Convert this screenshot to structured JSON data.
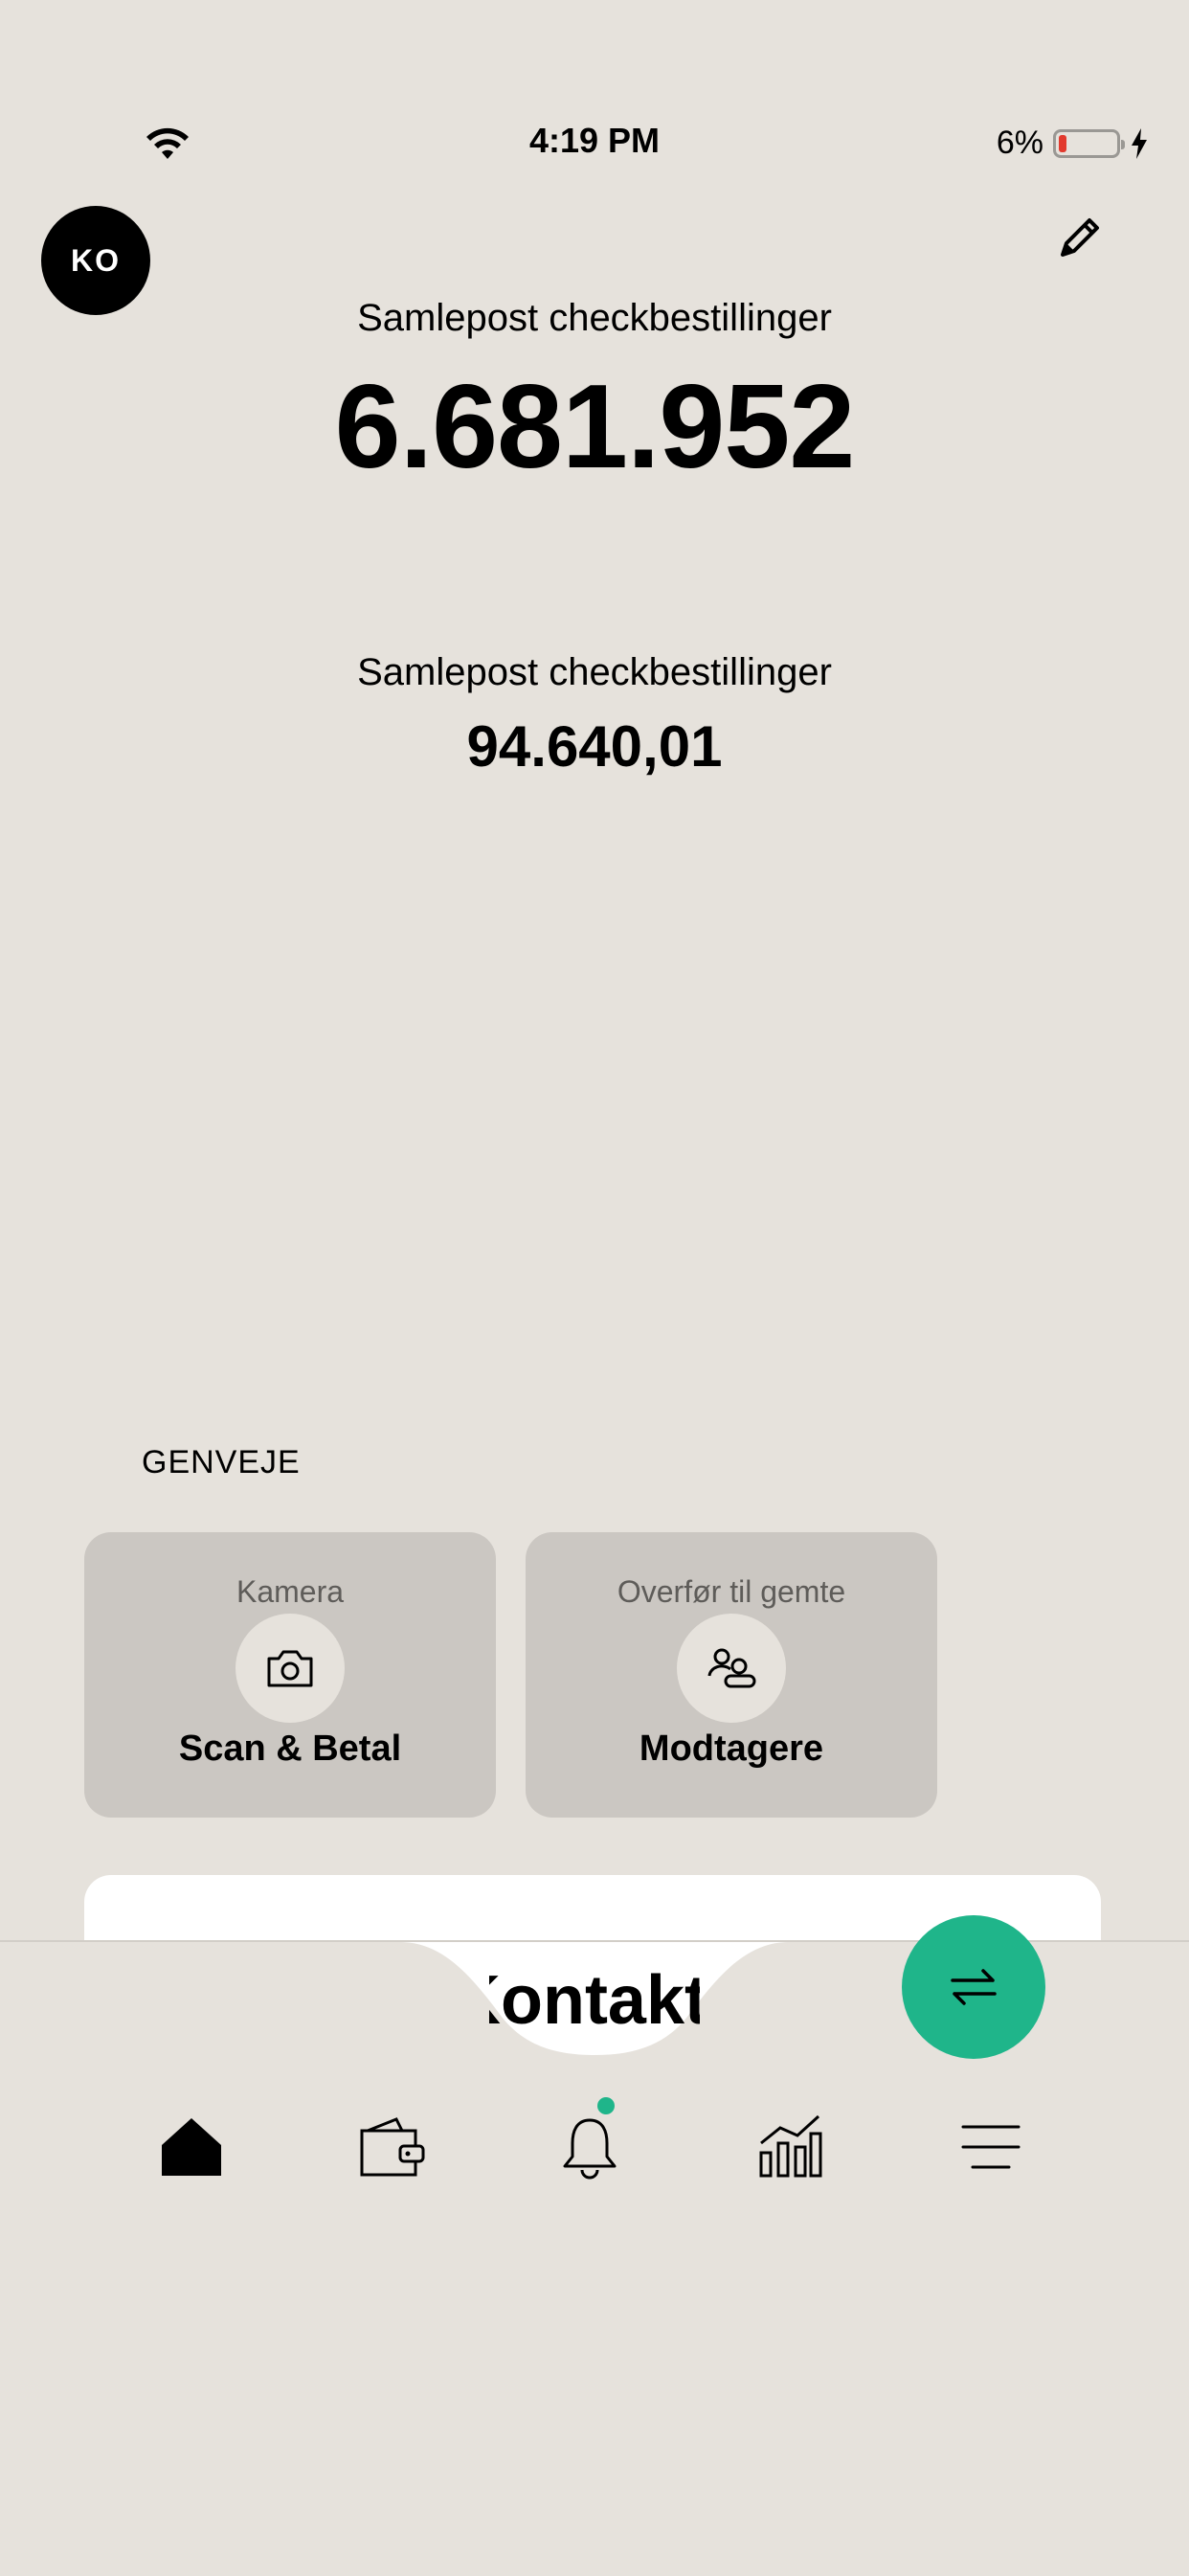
{
  "status_bar": {
    "time": "4:19 PM",
    "battery_percent": "6%",
    "battery_level": 0.06,
    "charging": true
  },
  "header": {
    "avatar_initials": "KO",
    "edit_icon": "pencil-icon"
  },
  "accounts": [
    {
      "label": "Samlepost checkbestillinger",
      "value": "6.681.952"
    },
    {
      "label": "Samlepost checkbestillinger",
      "value": "94.640,01"
    }
  ],
  "shortcuts": {
    "title": "GENVEJE",
    "items": [
      {
        "subtitle": "Kamera",
        "title": "Scan & Betal",
        "icon": "camera-icon"
      },
      {
        "subtitle": "Overfør til gemte",
        "title": "Modtagere",
        "icon": "recipients-icon"
      }
    ]
  },
  "contact_peek": "Kontakt",
  "fab": {
    "icon": "transfer-arrows-icon",
    "color": "#1fb58a"
  },
  "bottom_nav": [
    {
      "name": "home",
      "icon": "home-icon",
      "active": true
    },
    {
      "name": "wallet",
      "icon": "wallet-icon",
      "active": false
    },
    {
      "name": "notifications",
      "icon": "bell-icon",
      "active": false,
      "badge": true
    },
    {
      "name": "insights",
      "icon": "chart-icon",
      "active": false
    },
    {
      "name": "menu",
      "icon": "menu-icon",
      "active": false
    }
  ],
  "colors": {
    "background": "#e6e2dc",
    "accent": "#1fb58a",
    "card": "#cbc7c2"
  }
}
